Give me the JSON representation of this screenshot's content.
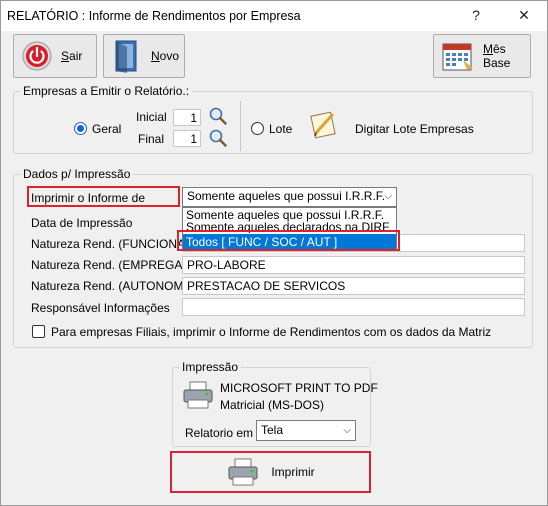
{
  "window": {
    "title": "RELATÓRIO : Informe de Rendimentos por Empresa",
    "help": "?",
    "close": "✕"
  },
  "toolbar": {
    "sair_prefix": "S",
    "sair_rest": "air",
    "novo_prefix": "N",
    "novo_rest": "ovo",
    "mes_prefix": "M",
    "mes_rest": "ês Base"
  },
  "empresas": {
    "title": "Empresas a Emitir o Relatório.:",
    "geral": "Geral",
    "inicial_label": "Inicial",
    "inicial_value": "1",
    "final_label": "Final",
    "final_value": "1",
    "lote": "Lote",
    "digitar_lote": "Digitar Lote Empresas"
  },
  "dados": {
    "title": "Dados p/ Impressão",
    "imprimir_informe_label": "Imprimir o Informe de",
    "imprimir_selected": "Somente aqueles que possui I.R.R.F.",
    "dropdown_options": [
      "Somente aqueles que possui I.R.R.F.",
      "Somente aqueles declarados na DIRF",
      "Todos [ FUNC / SOC / AUT ]"
    ],
    "data_impressao_label": "Data de Impressão",
    "nat_funcionario_label": "Natureza Rend. (FUNCIONA)",
    "nat_empregado_label": "Natureza Rend. (EMPREGAD)",
    "nat_empregado_value": "PRO-LABORE",
    "nat_autonomo_label": "Natureza Rend. (AUTONOMO)",
    "nat_autonomo_value": "PRESTACAO DE SERVICOS",
    "responsavel_label": "Responsável Informações",
    "filiais_checkbox": "Para empresas Filiais, imprimir o Informe de Rendimentos com os dados da Matriz"
  },
  "impressao": {
    "title": "Impressão",
    "printer_name": "MICROSOFT PRINT TO PDF",
    "printer_mode": "Matricial (MS-DOS)",
    "relatorio_label": "Relatorio em :",
    "relatorio_value": "Tela",
    "imprimir_button": "Imprimir"
  },
  "colors": {
    "highlight": "#d9232f",
    "selection": "#0078d7"
  }
}
